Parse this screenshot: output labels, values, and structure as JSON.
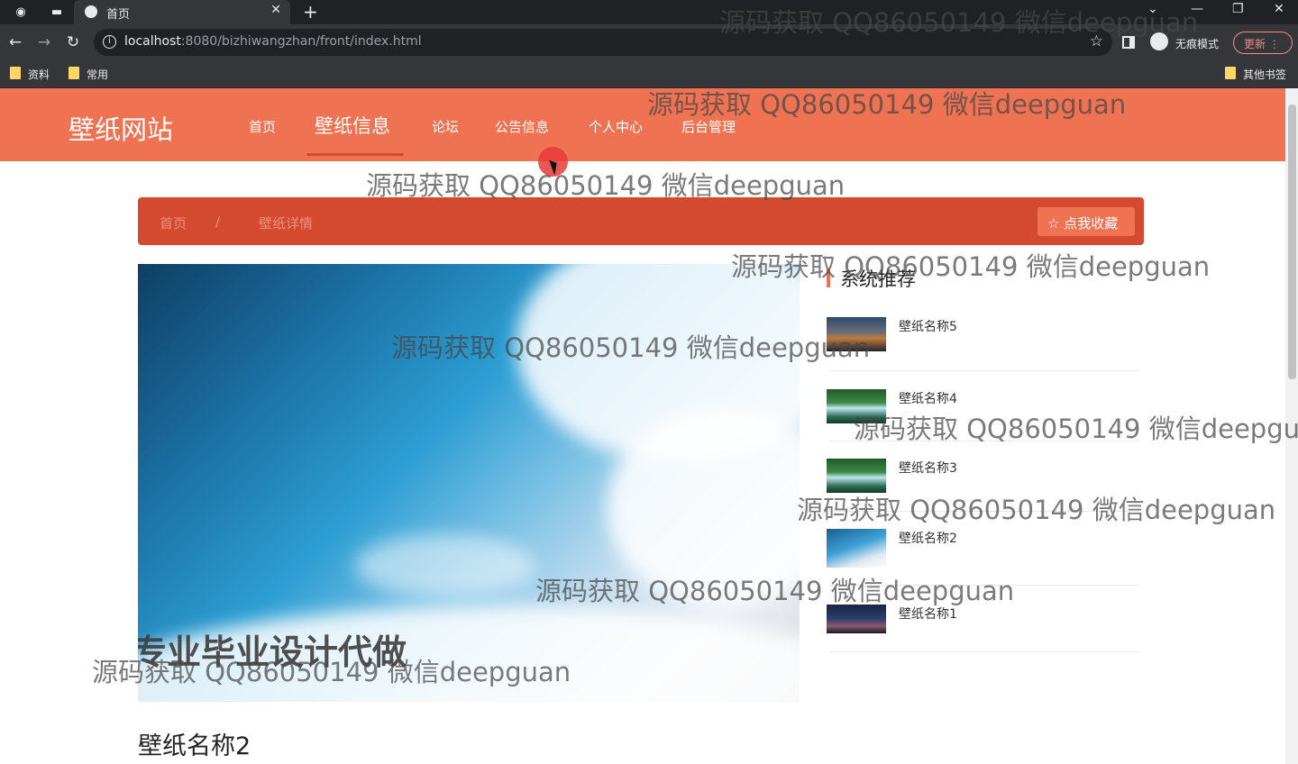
{
  "browser": {
    "tab_title": "首页",
    "url_host": "localhost",
    "url_rest": ":8080/bizhiwangzhan/front/index.html",
    "incognito_label": "无痕模式",
    "update_label": "更新",
    "bookmarks": [
      "资料",
      "常用"
    ],
    "other_bookmarks": "其他书签"
  },
  "site": {
    "logo": "壁纸网站",
    "nav": [
      {
        "label": "首页"
      },
      {
        "label": "壁纸信息"
      },
      {
        "label": "论坛"
      },
      {
        "label": "公告信息"
      },
      {
        "label": "个人中心"
      },
      {
        "label": "后台管理"
      }
    ],
    "breadcrumb": {
      "home": "首页",
      "separator": "/",
      "current": "壁纸详情"
    },
    "favorite_button": "点我收藏",
    "hero_overlay": "专业毕业设计代做",
    "detail_title": "壁纸名称2",
    "recommend_title": "系统推荐",
    "recommend": [
      {
        "name": "壁纸名称5",
        "thumb": "sunset-city"
      },
      {
        "name": "壁纸名称4",
        "thumb": "waterfall"
      },
      {
        "name": "壁纸名称3",
        "thumb": "waterfall"
      },
      {
        "name": "壁纸名称2",
        "thumb": "sky-clouds"
      },
      {
        "name": "壁纸名称1",
        "thumb": "city-night"
      }
    ]
  },
  "watermark": "源码获取 QQ86050149 微信deepguan",
  "colors": {
    "header": "#ef7352",
    "breadcrumb": "#d44a31"
  }
}
